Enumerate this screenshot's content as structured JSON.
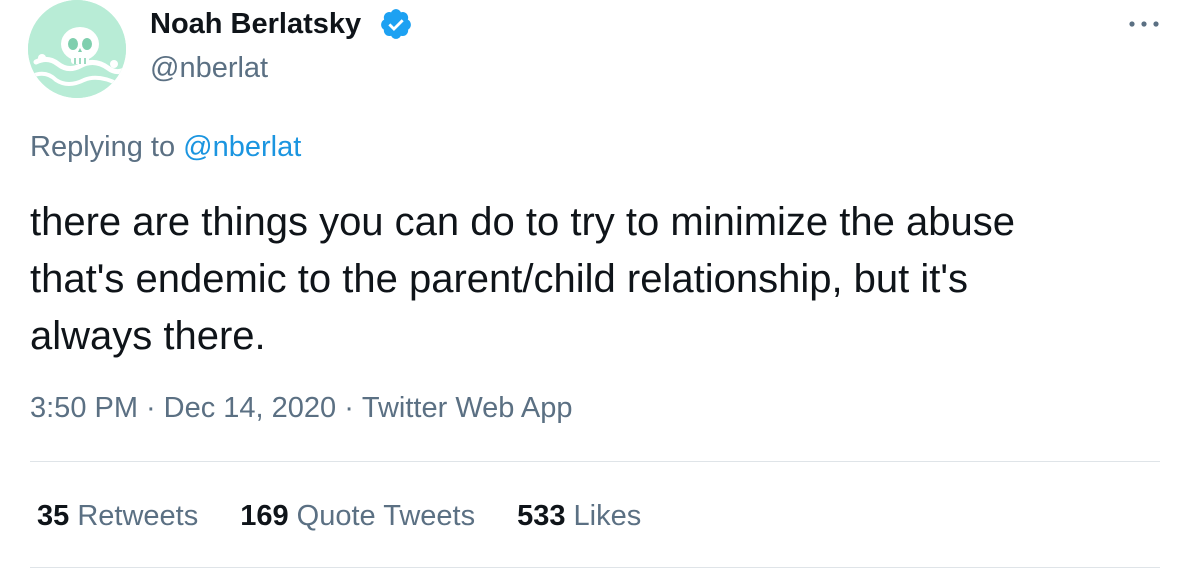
{
  "author": {
    "display_name": "Noah Berlatsky",
    "handle": "@nberlat",
    "verified": true
  },
  "reply": {
    "prefix": "Replying to",
    "mention": "@nberlat"
  },
  "tweet": {
    "text": "there are things you can do to try to minimize the abuse\nthat's endemic to the parent/child relationship, but it's\nalways there."
  },
  "meta": {
    "time": "3:50 PM",
    "separator": "·",
    "date": "Dec 14, 2020",
    "source": "Twitter Web App"
  },
  "stats": {
    "retweets_count": "35",
    "retweets_label": "Retweets",
    "quotes_count": "169",
    "quotes_label": "Quote Tweets",
    "likes_count": "533",
    "likes_label": "Likes"
  },
  "colors": {
    "text_primary": "#0f1419",
    "text_secondary": "#5b7083",
    "accent": "#1b95e0",
    "verified_badge": "#1da1f2",
    "divider": "#dfe4e8",
    "avatar_bg": "#b8ecd6"
  },
  "icons": {
    "verified": "verified-badge-icon",
    "more": "more-options-icon",
    "avatar": "skull-avatar"
  }
}
